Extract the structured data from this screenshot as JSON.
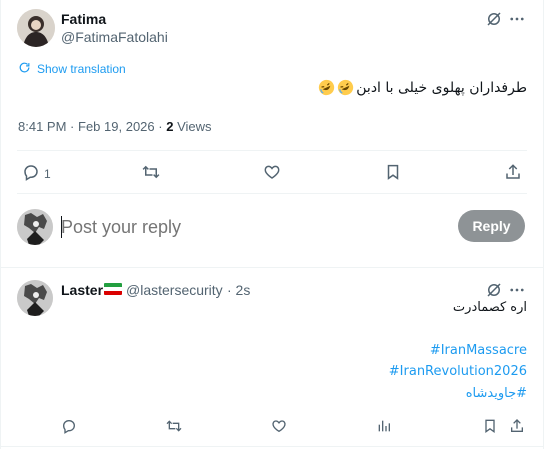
{
  "tweet": {
    "author_name": "Fatima",
    "author_handle": "@FatimaFatolahi",
    "show_translation": "Show translation",
    "text": "طرفداران پهلوی خیلی با ادبن",
    "time": "8:41 PM",
    "date": "Feb 19, 2026",
    "separator": "·",
    "views_count": "2",
    "views_label": "Views",
    "replies_count": "1"
  },
  "composer": {
    "placeholder": "Post your reply",
    "reply_button": "Reply"
  },
  "reply": {
    "author_name": "Laster",
    "author_handle": "@lastersecurity",
    "time_ago": "· 2s",
    "text": "اره کصمادرت",
    "hashtags": [
      "#IranMassacre",
      "#IranRevolution2026",
      "#جاویدشاه"
    ]
  },
  "colors": {
    "link": "#1d9bf0",
    "secondary": "#536471",
    "primary_text": "#0f1419",
    "reply_button_bg": "#8e9396"
  },
  "icons": [
    "grok-icon",
    "more-icon",
    "translate-icon",
    "reply-icon",
    "retweet-icon",
    "like-icon",
    "bookmark-icon",
    "share-icon",
    "views-icon",
    "iran-flag",
    "rofl-emoji"
  ]
}
